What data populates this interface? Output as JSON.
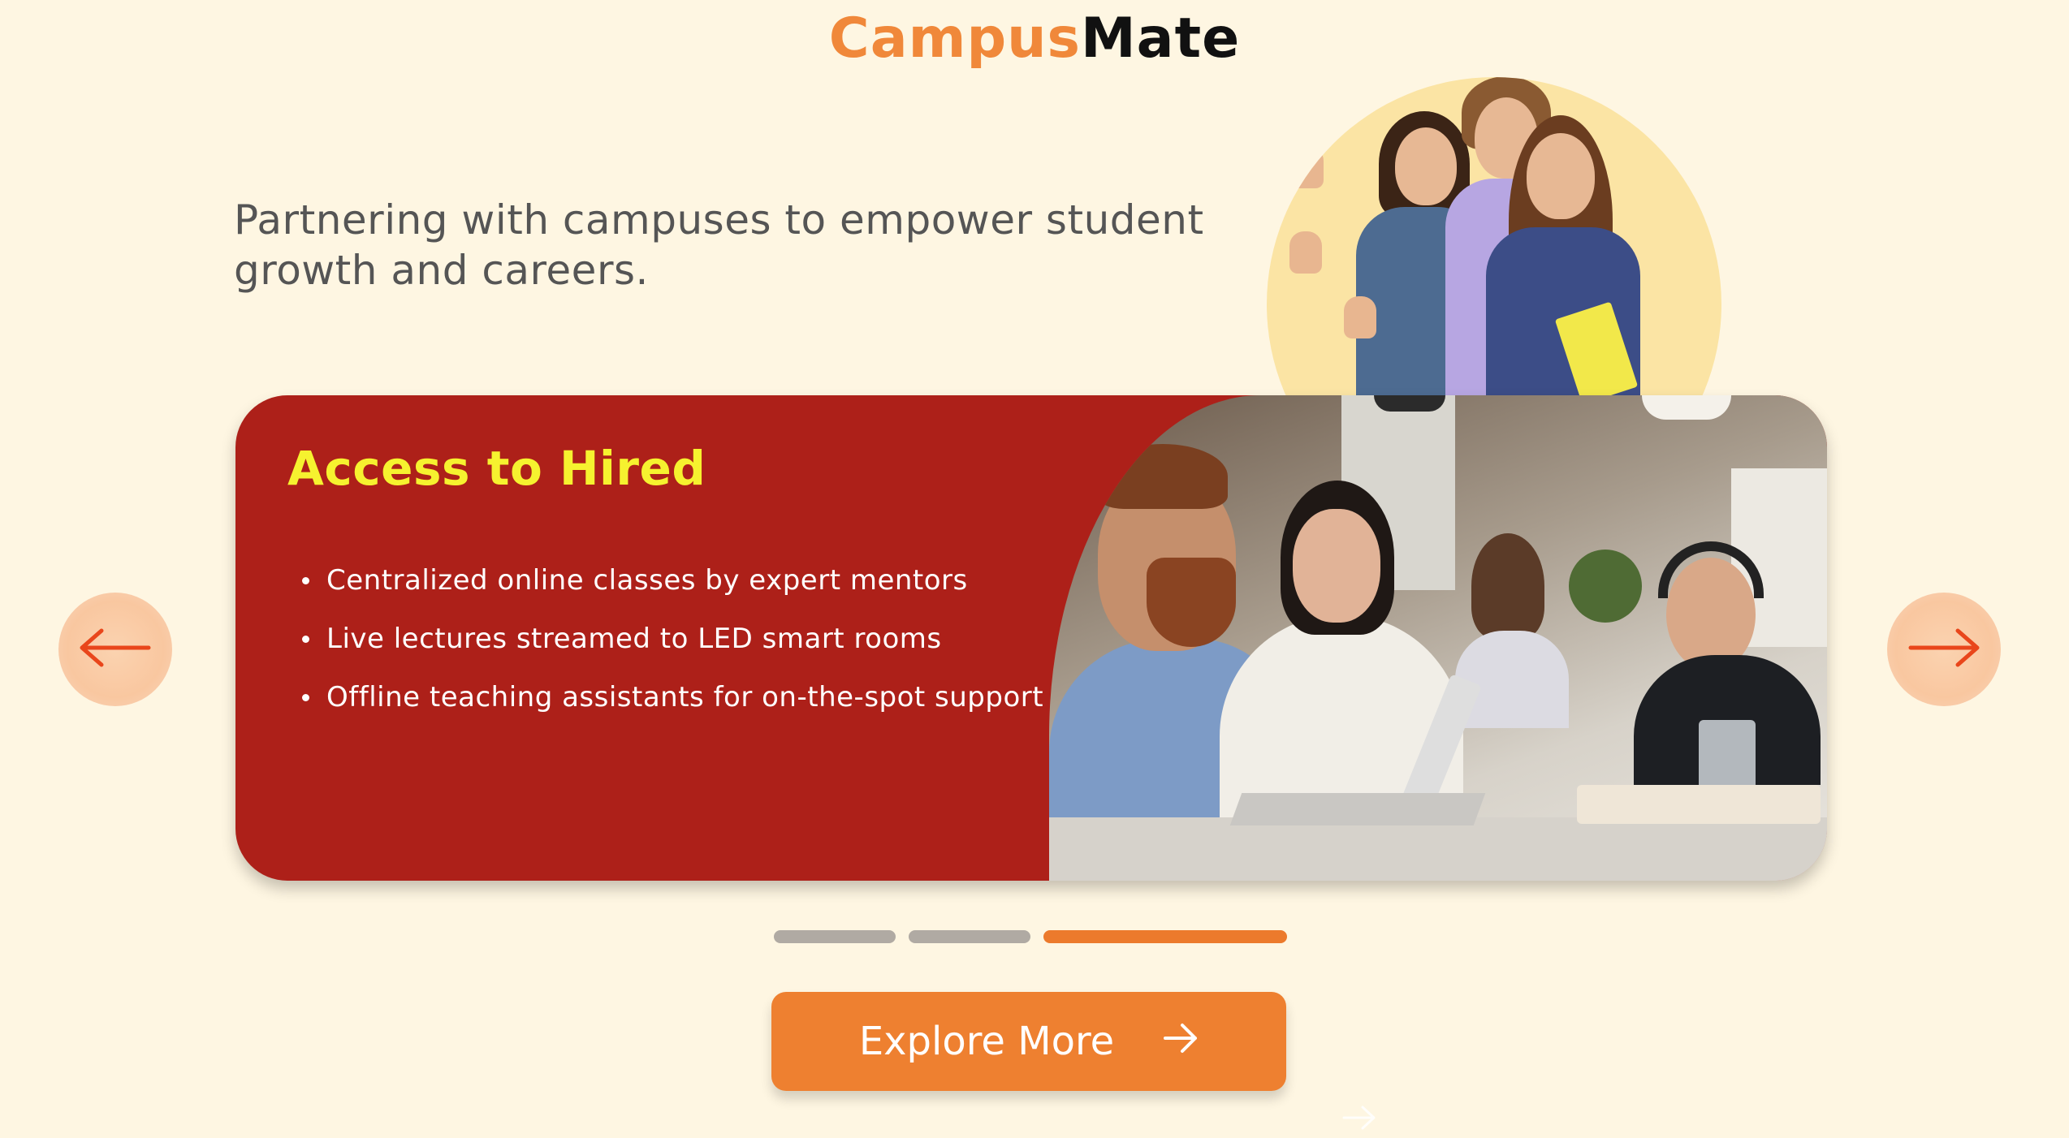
{
  "brand": {
    "part1": "Campus",
    "part2": "Mate"
  },
  "tagline": "Partnering with campuses to empower student growth and careers.",
  "slide": {
    "title": "Access to Hired",
    "bullets": [
      "Centralized online classes by expert mentors",
      "Live lectures streamed to LED smart rooms",
      "Offline teaching assistants for on-the-spot support"
    ]
  },
  "carousel": {
    "slide_count": 3,
    "active_index": 2
  },
  "cta": {
    "label": "Explore More"
  },
  "icons": {
    "prev": "arrow-left-icon",
    "next": "arrow-right-icon",
    "cta": "arrow-right-icon"
  },
  "colors": {
    "background": "#fef6e2",
    "brand_orange": "#f0883a",
    "card_red": "#ad2019",
    "title_yellow": "#f6f22f",
    "active_dot": "#ec7a2c",
    "inactive_dot": "#b0aaa3",
    "cta": "#ee8030"
  }
}
